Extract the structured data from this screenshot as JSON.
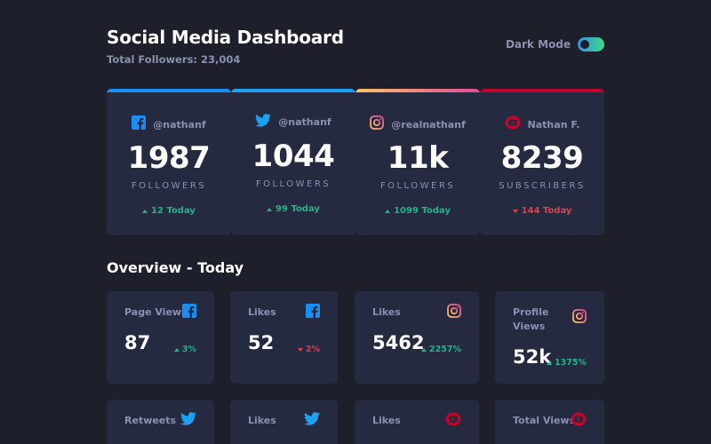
{
  "header": {
    "title": "Social Media Dashboard",
    "total_followers": "Total Followers: 23,004",
    "dark_mode_label": "Dark Mode"
  },
  "colors": {
    "facebook": "#198ff5",
    "twitter": "#1ca0f2",
    "instagram": "#df4996",
    "youtube": "#c4032b",
    "up": "#1eb589",
    "down": "#dc414c",
    "card_bg": "#252a41",
    "page_bg": "#1d1f2a"
  },
  "cards": [
    {
      "platform": "facebook",
      "icon": "facebook-icon",
      "handle": "@nathanf",
      "count": "1987",
      "unit": "FOLLOWERS",
      "today": "12 Today",
      "trend": "up"
    },
    {
      "platform": "twitter",
      "icon": "twitter-icon",
      "handle": "@nathanf",
      "count": "1044",
      "unit": "FOLLOWERS",
      "today": "99 Today",
      "trend": "up"
    },
    {
      "platform": "instagram",
      "icon": "instagram-icon",
      "handle": "@realnathanf",
      "count": "11k",
      "unit": "FOLLOWERS",
      "today": "1099 Today",
      "trend": "up"
    },
    {
      "platform": "youtube",
      "icon": "youtube-icon",
      "handle": "Nathan F.",
      "count": "8239",
      "unit": "SUBSCRIBERS",
      "today": "144 Today",
      "trend": "down"
    }
  ],
  "overview": {
    "title": "Overview - Today",
    "row1": [
      {
        "label": "Page Views",
        "icon": "facebook-icon",
        "value": "87",
        "change": "3%",
        "trend": "up"
      },
      {
        "label": "Likes",
        "icon": "facebook-icon",
        "value": "52",
        "change": "2%",
        "trend": "down"
      },
      {
        "label": "Likes",
        "icon": "instagram-icon",
        "value": "5462",
        "change": "2257%",
        "trend": "up"
      },
      {
        "label": "Profile Views",
        "icon": "instagram-icon",
        "value": "52k",
        "change": "1375%",
        "trend": "up"
      }
    ],
    "row2": [
      {
        "label": "Retweets",
        "icon": "twitter-icon"
      },
      {
        "label": "Likes",
        "icon": "twitter-icon"
      },
      {
        "label": "Likes",
        "icon": "youtube-icon"
      },
      {
        "label": "Total Views",
        "icon": "youtube-icon"
      }
    ]
  }
}
